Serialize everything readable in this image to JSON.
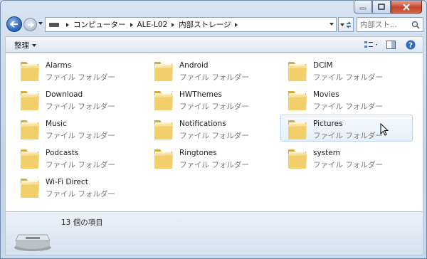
{
  "breadcrumb": [
    "コンピューター",
    "ALE-L02",
    "内部ストレージ"
  ],
  "search": {
    "placeholder": "内部スト..."
  },
  "toolbar": {
    "organize_label": "整理"
  },
  "items": [
    {
      "name": "Alarms",
      "type": "ファイル フォルダー"
    },
    {
      "name": "Android",
      "type": "ファイル フォルダー"
    },
    {
      "name": "DCIM",
      "type": "ファイル フォルダー"
    },
    {
      "name": "Download",
      "type": "ファイル フォルダー"
    },
    {
      "name": "HWThemes",
      "type": "ファイル フォルダー"
    },
    {
      "name": "Movies",
      "type": "ファイル フォルダー"
    },
    {
      "name": "Music",
      "type": "ファイル フォルダー"
    },
    {
      "name": "Notifications",
      "type": "ファイル フォルダー"
    },
    {
      "name": "Pictures",
      "type": "ファイル フォルダー"
    },
    {
      "name": "Podcasts",
      "type": "ファイル フォルダー"
    },
    {
      "name": "Ringtones",
      "type": "ファイル フォルダー"
    },
    {
      "name": "system",
      "type": "ファイル フォルダー"
    },
    {
      "name": "Wi-Fi Direct",
      "type": "ファイル フォルダー"
    }
  ],
  "hovered_item": "Pictures",
  "details": {
    "count_label": "13 個の項目"
  },
  "colors": {
    "accent": "#2f6cc0",
    "folder": "#f2cf6b",
    "hover_border": "#b8d6fb"
  }
}
